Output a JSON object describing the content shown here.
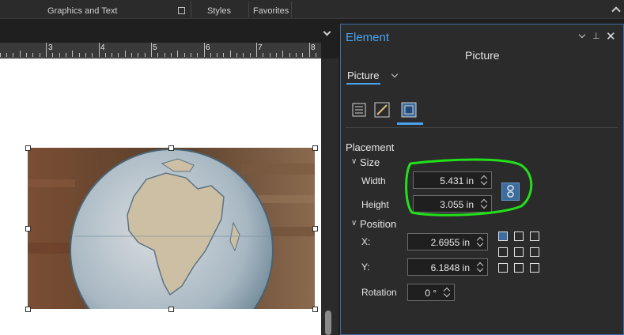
{
  "ribbon": {
    "groups": [
      "Graphics and Text",
      "Styles",
      "Favorites"
    ]
  },
  "ruler": {
    "numbers": [
      "3",
      "4",
      "5",
      "6",
      "7",
      "8"
    ]
  },
  "panel": {
    "title": "Element",
    "subtitle": "Picture",
    "tab_label": "Picture",
    "section_placement": "Placement",
    "group_size": "Size",
    "width_label": "Width",
    "width_value": "5.431 in",
    "height_label": "Height",
    "height_value": "3.055 in",
    "group_position": "Position",
    "x_label": "X:",
    "x_value": "2.6955 in",
    "y_label": "Y:",
    "y_value": "6.1848 in",
    "rotation_label": "Rotation",
    "rotation_value": "0 °"
  },
  "colors": {
    "accent": "#4aa3f0",
    "highlight": "#22e01a",
    "panel_bg": "#2b2b2b"
  },
  "icons": [
    "collapse-ribbon-icon",
    "dialog-launcher-icon",
    "panel-dropdown-icon",
    "pin-icon",
    "close-icon",
    "options-tab-icon",
    "symbol-tab-icon",
    "display-tab-icon",
    "lock-aspect-icon",
    "anchor-grid-icon"
  ]
}
